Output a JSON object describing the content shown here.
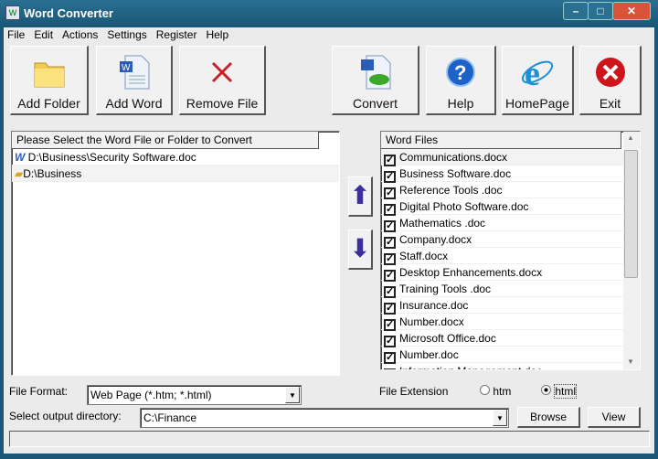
{
  "window": {
    "title": "Word Converter"
  },
  "menu": [
    "File",
    "Edit",
    "Actions",
    "Settings",
    "Register",
    "Help"
  ],
  "toolbar": {
    "add_folder": "Add Folder",
    "add_word": "Add Word",
    "remove_file": "Remove File",
    "convert": "Convert",
    "help": "Help",
    "homepage": "HomePage",
    "exit": "Exit"
  },
  "left_list": {
    "header": "Please Select the Word File or Folder to Convert",
    "items": [
      "D:\\Business\\Security Software.doc",
      "D:\\Business"
    ]
  },
  "right_list": {
    "header": "Word Files",
    "items": [
      "Communications.docx",
      "Business Software.doc",
      "Reference Tools .doc",
      "Digital Photo Software.doc",
      "Mathematics .doc",
      "Company.docx",
      "Staff.docx",
      "Desktop Enhancements.docx",
      "Training Tools .doc",
      "Insurance.doc",
      "Number.docx",
      "Microsoft Office.doc",
      "Number.doc",
      "Information Management.doc"
    ]
  },
  "format": {
    "label": "File Format:",
    "value": "Web Page (*.htm; *.html)"
  },
  "extension": {
    "label": "File Extension",
    "options": [
      "htm",
      "html"
    ],
    "selected": "html"
  },
  "output": {
    "label": "Select  output directory:",
    "value": "C:\\Finance",
    "browse": "Browse",
    "view": "View"
  }
}
